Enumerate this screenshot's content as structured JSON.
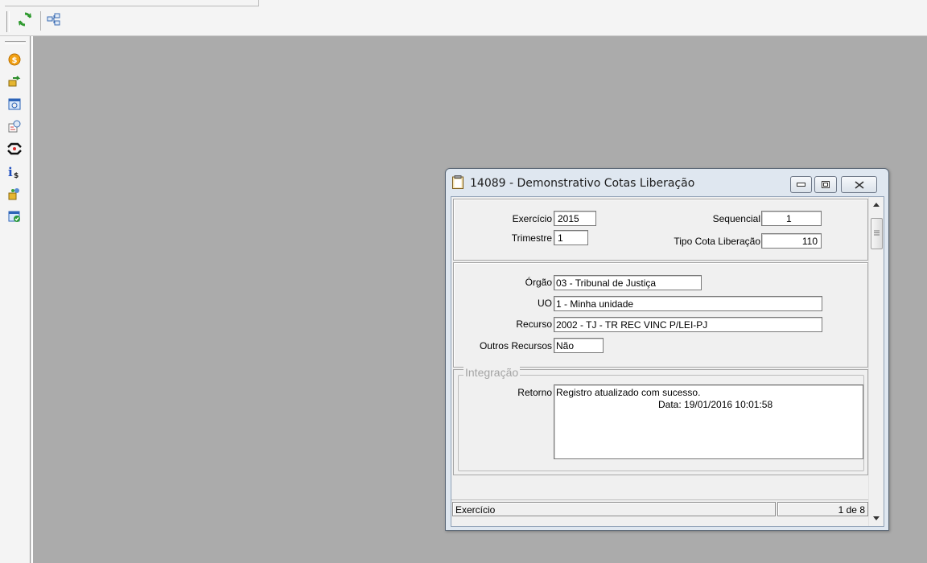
{
  "toolbar": {
    "refresh_icon": "refresh-icon",
    "tree_icon": "tree-view-icon"
  },
  "sidebar": {
    "icons": [
      "coin-icon",
      "transfer-icon",
      "calendar-icon",
      "report-icon",
      "link-icon",
      "info-money-icon",
      "users-icon",
      "check-window-icon"
    ]
  },
  "window": {
    "title": "14089 - Demonstrativo Cotas Liberação"
  },
  "form": {
    "exercicio_label": "Exercício",
    "exercicio_value": "2015",
    "trimestre_label": "Trimestre",
    "trimestre_value": "1",
    "sequencial_label": "Sequencial",
    "sequencial_value": "1",
    "tipo_cota_label": "Tipo Cota Liberação",
    "tipo_cota_value": "110",
    "orgao_label": "Órgão",
    "orgao_value": "03 - Tribunal de Justiça",
    "uo_label": "UO",
    "uo_value": "1 -  Minha unidade",
    "recurso_label": "Recurso",
    "recurso_value": "2002 - TJ - TR REC VINC P/LEI-PJ",
    "outros_label": "Outros Recursos",
    "outros_value": "Não"
  },
  "integracao": {
    "title": "Integração",
    "retorno_label": "Retorno",
    "retorno_line1": "Registro atualizado com sucesso.",
    "retorno_line2": "Data: 19/01/2016 10:01:58"
  },
  "status": {
    "field": "Exercício",
    "record": "1 de 8"
  },
  "colors": {
    "mdi_background": "#ababab",
    "window_frame": "#dfe7f0"
  }
}
